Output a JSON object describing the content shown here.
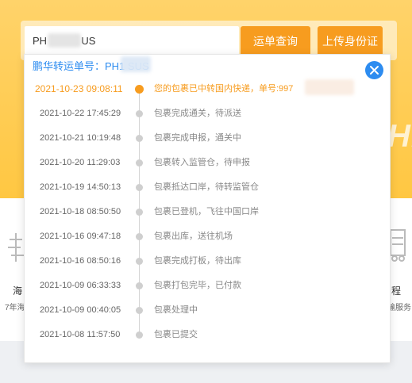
{
  "search": {
    "value": "PH            US",
    "query_button": "运单查询",
    "upload_button": "上传身份证"
  },
  "popup": {
    "header": "鹏华转运单号：PH1          SUS",
    "events": [
      {
        "time": "2021-10-23 09:08:11",
        "text": "您的包裹已中转国内快递，单号:997",
        "active": true
      },
      {
        "time": "2021-10-22 17:45:29",
        "text": "包裹完成通关，待派送"
      },
      {
        "time": "2021-10-21 10:19:48",
        "text": "包裹完成申报，通关中"
      },
      {
        "time": "2021-10-20 11:29:03",
        "text": "包裹转入监管仓，待申报"
      },
      {
        "time": "2021-10-19 14:50:13",
        "text": "包裹抵达口岸，待转监管仓"
      },
      {
        "time": "2021-10-18 08:50:50",
        "text": "包裹已登机，飞往中国口岸"
      },
      {
        "time": "2021-10-16 09:47:18",
        "text": "包裹出库，送往机场"
      },
      {
        "time": "2021-10-16 08:50:16",
        "text": "包裹完成打板，待出库"
      },
      {
        "time": "2021-10-09 06:33:33",
        "text": "包裹打包完毕，已付款"
      },
      {
        "time": "2021-10-09 00:40:05",
        "text": "包裹处理中"
      },
      {
        "time": "2021-10-08 11:57:50",
        "text": "包裹已提交"
      }
    ]
  },
  "background": {
    "watermark": "HI",
    "left_label": "海",
    "left_sub": "7年海",
    "right_label": "程",
    "right_sub": "输服务"
  },
  "colors": {
    "accent": "#f79c1f",
    "link": "#2d8cf0",
    "hero": "#ffc742"
  }
}
